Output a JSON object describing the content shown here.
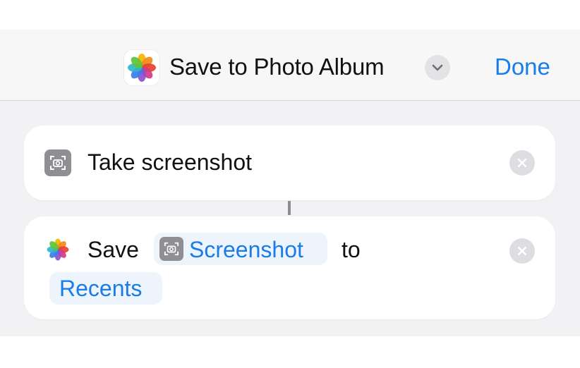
{
  "header": {
    "title": "Save to Photo Album",
    "done_label": "Done",
    "app_icon": "photos-icon",
    "chevron_icon": "chevron-down-icon"
  },
  "actions": [
    {
      "icon": "screenshot-icon",
      "label": "Take screenshot",
      "remove_icon": "close-icon"
    },
    {
      "icon": "photos-icon",
      "verb": "Save",
      "variable": "Screenshot",
      "variable_icon": "screenshot-icon",
      "preposition": "to",
      "album": "Recents",
      "remove_icon": "close-icon"
    }
  ],
  "colors": {
    "accent": "#1a7ce8",
    "background": "#f2f2f4",
    "card": "#ffffff"
  }
}
